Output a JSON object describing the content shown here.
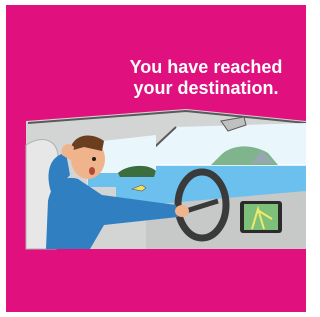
{
  "caption": {
    "line1": "You have reached",
    "line2": "your destination."
  },
  "colors": {
    "background": "#e0117f",
    "caption_text": "#ffffff",
    "car_interior": "#d3d4d4",
    "water": "#6cc0ee",
    "shirt": "#2f7fc1"
  },
  "illustration": {
    "icons": [
      "man-driver-icon",
      "steering-wheel-icon",
      "gps-navigator-icon",
      "sinking-car-icon",
      "fish-icon"
    ]
  }
}
